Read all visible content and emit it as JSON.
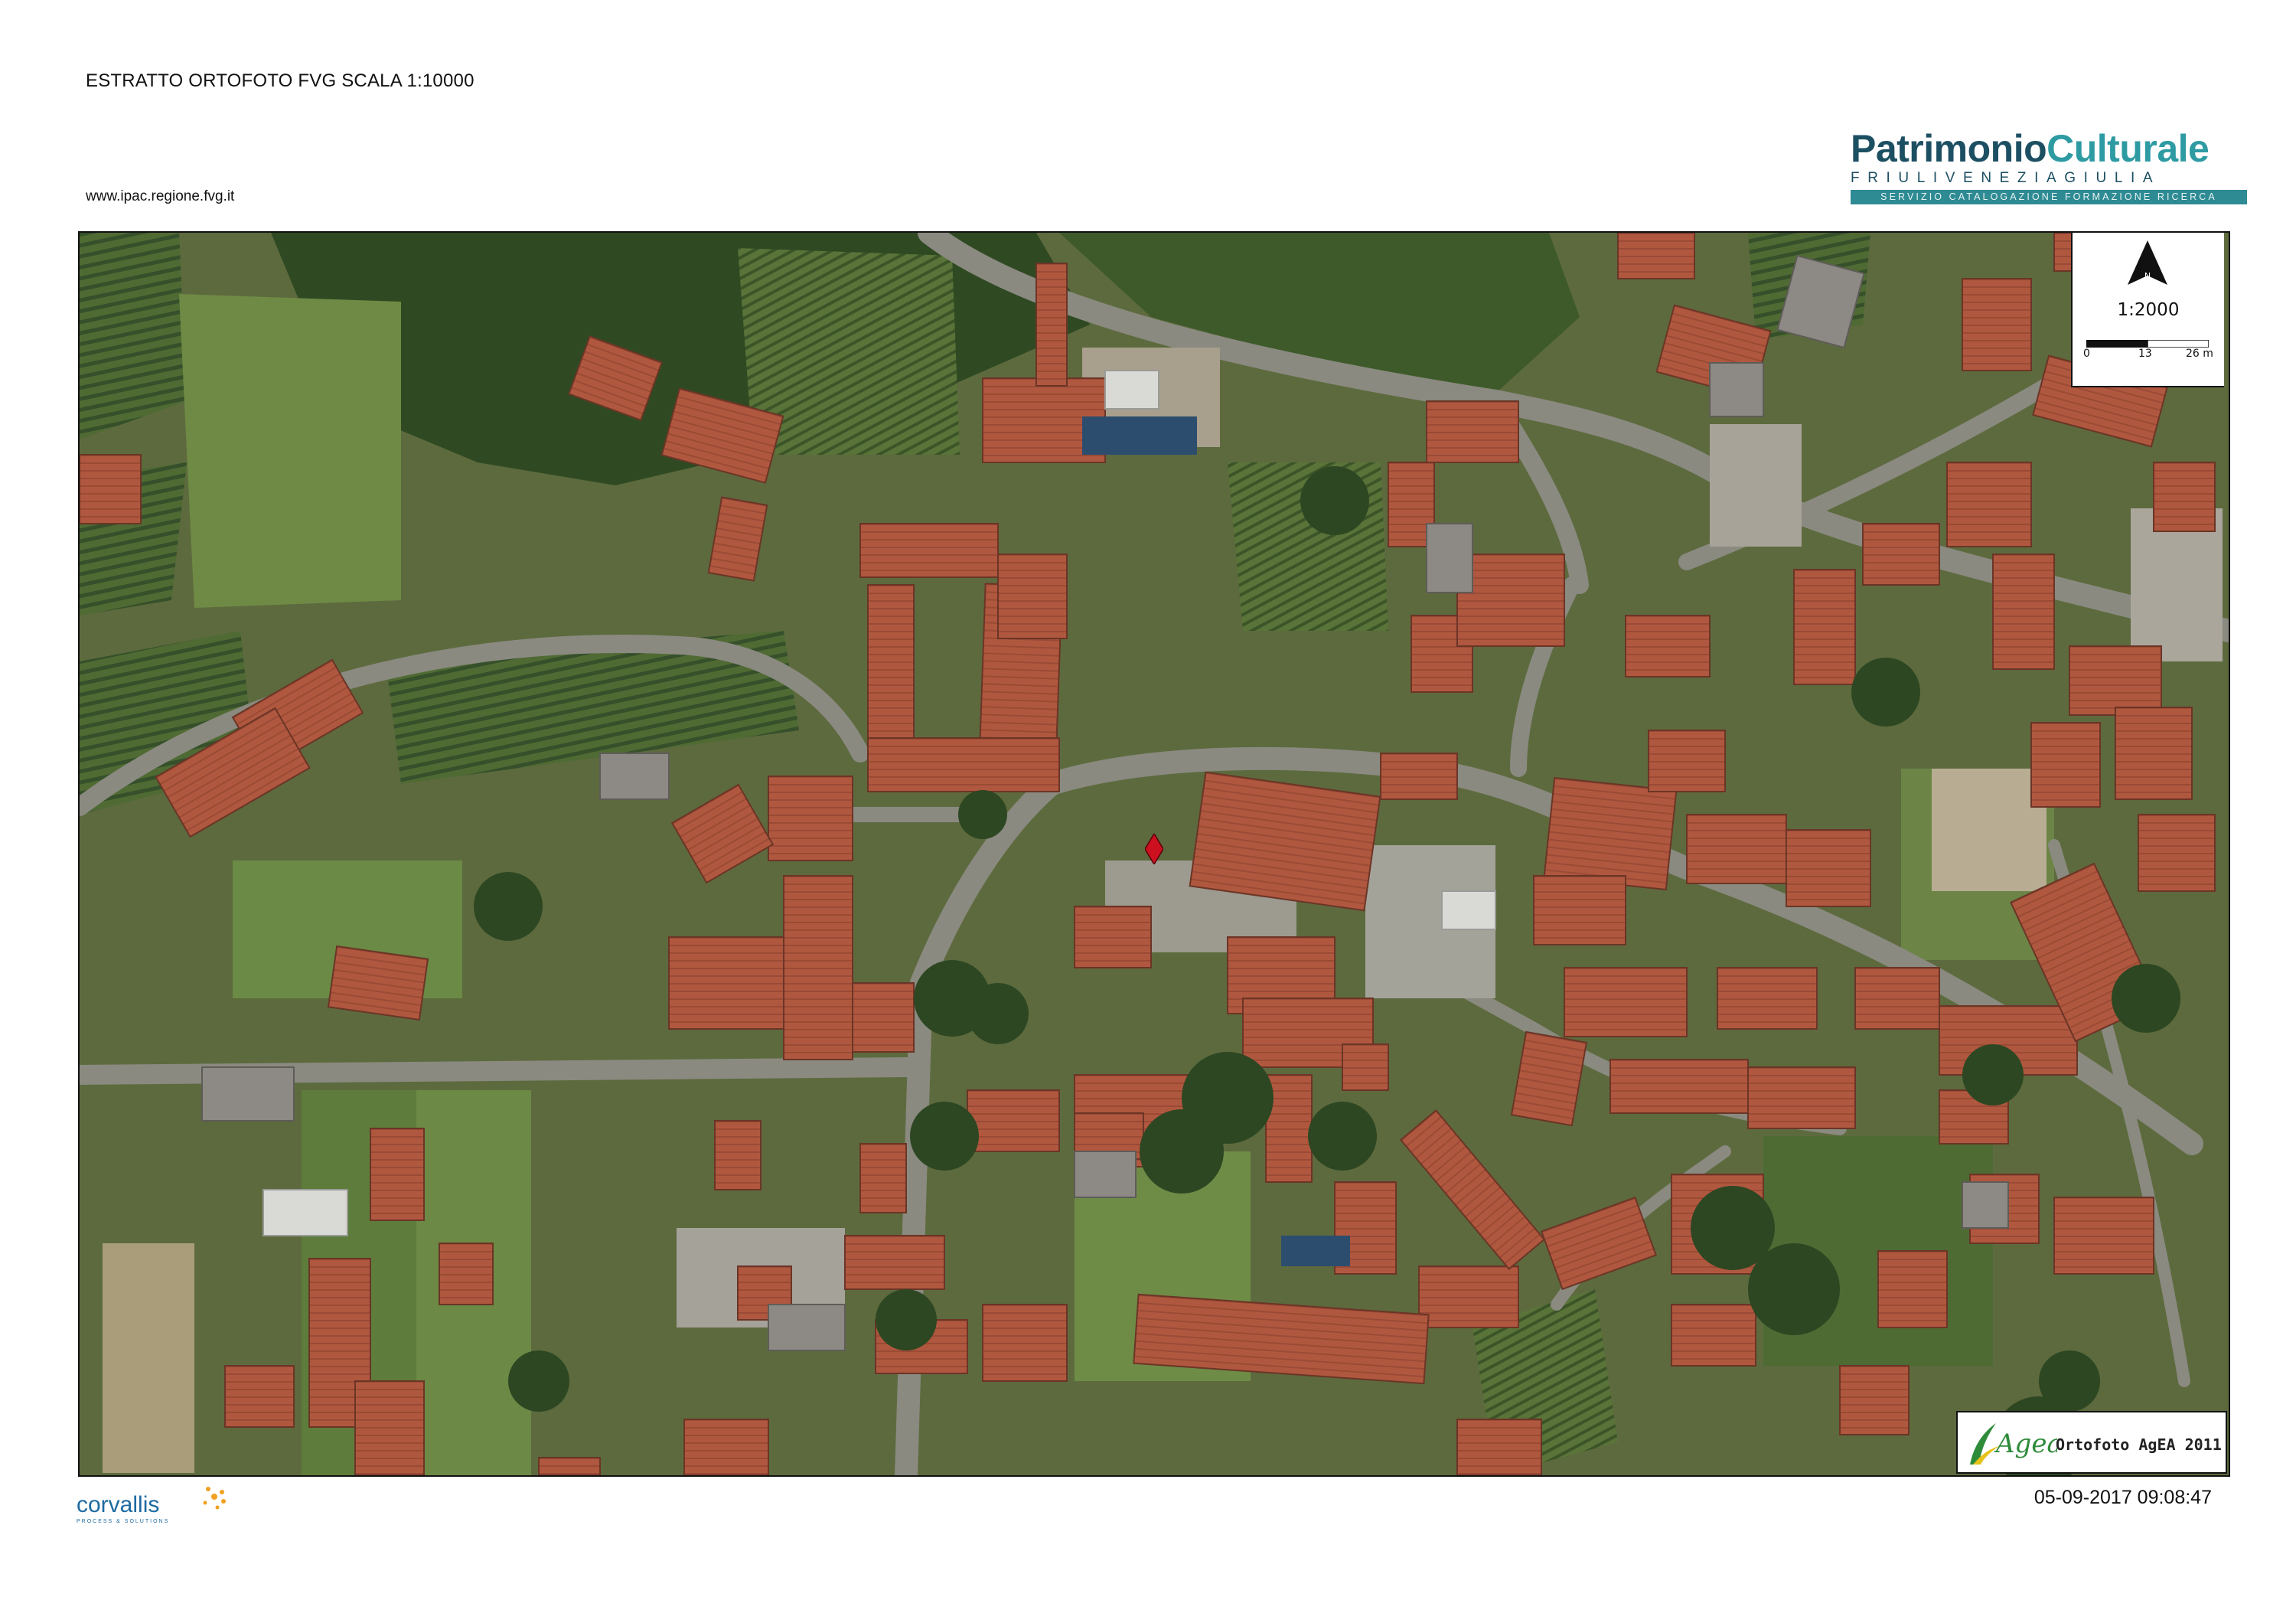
{
  "header": {
    "title": "ESTRATTO ORTOFOTO FVG SCALA 1:10000",
    "url": "www.ipac.regione.fvg.it"
  },
  "brand": {
    "name_part1": "Patrimonio",
    "name_part2": "Culturale",
    "region": "FRIULIVENEZIAGIULIA",
    "service": "SERVIZIO CATALOGAZIONE FORMAZIONE RICERCA",
    "colors": {
      "primary": "#1d4f63",
      "accent": "#2e9ba3"
    }
  },
  "map": {
    "north_letter": "N",
    "scale_ratio": "1:2000",
    "scale_ticks": [
      "0",
      "13",
      "26 m"
    ],
    "marker_color": "#cc1020",
    "north_icon": "north-arrow-icon",
    "marker_icon": "location-diamond-icon"
  },
  "agea": {
    "logo_text": "Agea",
    "caption": "Ortofoto AgEA 2011"
  },
  "footer": {
    "corvallis_logo_text": "corvallis",
    "corvallis_tagline": "PROCESS & SOLUTIONS",
    "timestamp": "05-09-2017 09:08:47"
  }
}
